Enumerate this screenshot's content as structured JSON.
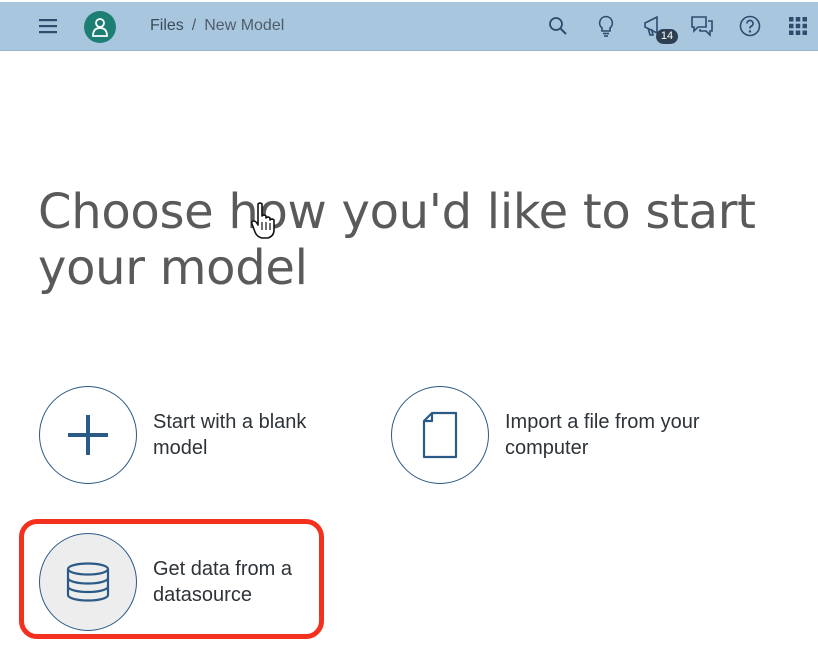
{
  "header": {
    "breadcrumb": {
      "files": "Files",
      "separator": "/",
      "current": "New Model"
    },
    "notifications_count": "14",
    "icons": [
      "menu-icon",
      "user-icon",
      "search-icon",
      "lightbulb-icon",
      "announcement-icon",
      "chat-icon",
      "help-icon",
      "app-grid-icon"
    ],
    "colors": {
      "bar": "#a9c6df",
      "avatar": "#1d7f73",
      "icon": "#2e4c6d"
    }
  },
  "main": {
    "headline": "Choose how you'd like to start your model",
    "options": [
      {
        "label": "Start with a blank model",
        "icon": "plus-icon"
      },
      {
        "label": "Import a file from your computer",
        "icon": "file-icon"
      },
      {
        "label": "Get data from a datasource",
        "icon": "database-icon",
        "highlighted": true
      }
    ],
    "colors": {
      "highlight": "#f4301e",
      "circle_border": "#2b5a86"
    }
  }
}
